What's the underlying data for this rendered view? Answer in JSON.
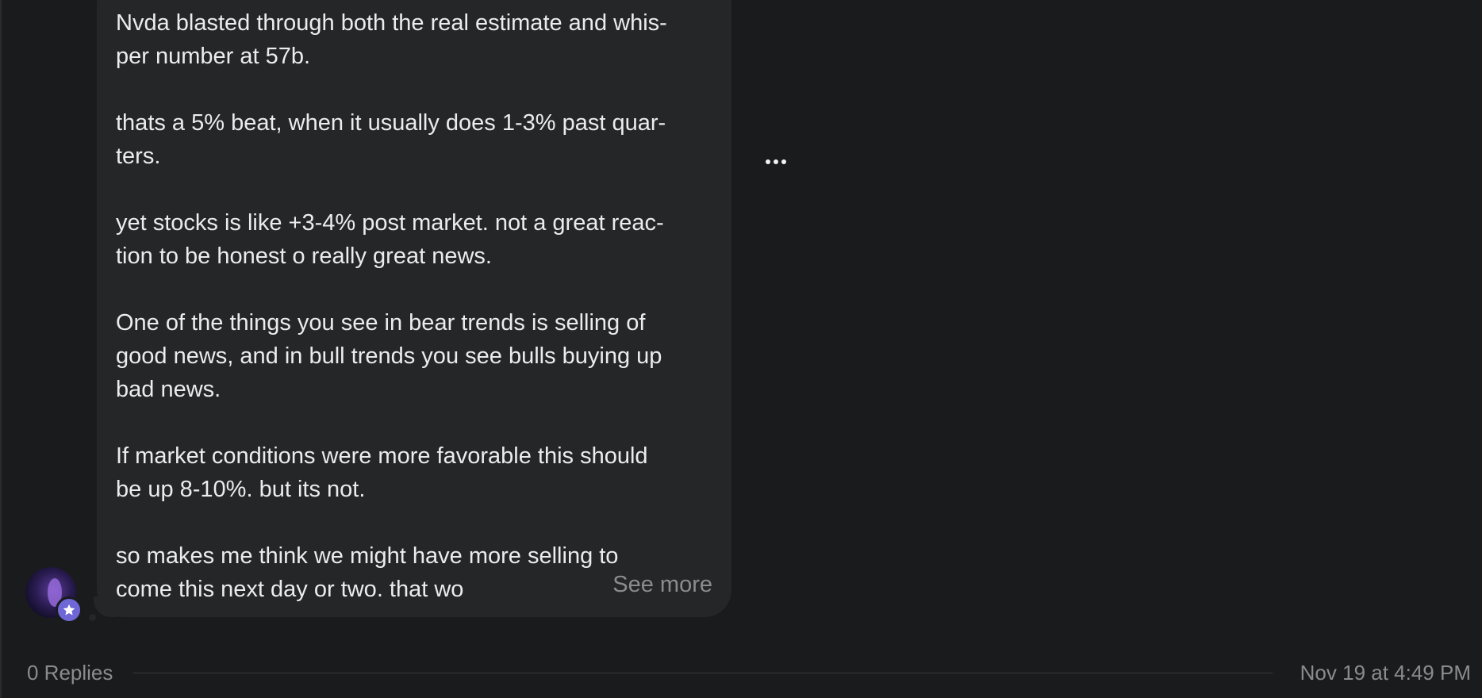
{
  "post": {
    "paragraphs": [
      "Nvda blasted through both the real estimate and whis-\nper number at 57b.",
      "thats a 5% beat, when it usually does 1-3% past quar-\nters.",
      "yet stocks is like +3-4% post market. not a great reac-\ntion to be honest o really great news.",
      "One of the things you see in bear trends is selling of\ngood news, and in bull trends you see bulls buying up\nbad news.",
      "If market conditions were more favorable this should\nbe up 8-10%. but its not.",
      "so makes me think we might have more selling to\ncome this next day or two. that wo"
    ],
    "see_more_label": "See more",
    "more_icon": "ellipsis-icon"
  },
  "author": {
    "avatar_icon": "user-avatar",
    "badge_icon": "star-icon",
    "badge_color": "#6f67d6"
  },
  "footer": {
    "replies_label": "0 Replies",
    "timestamp": "Nov 19 at 4:49 PM"
  },
  "colors": {
    "background": "#1a1b1d",
    "bubble": "#252627",
    "text": "#ececec",
    "muted": "#8b8c8f"
  }
}
